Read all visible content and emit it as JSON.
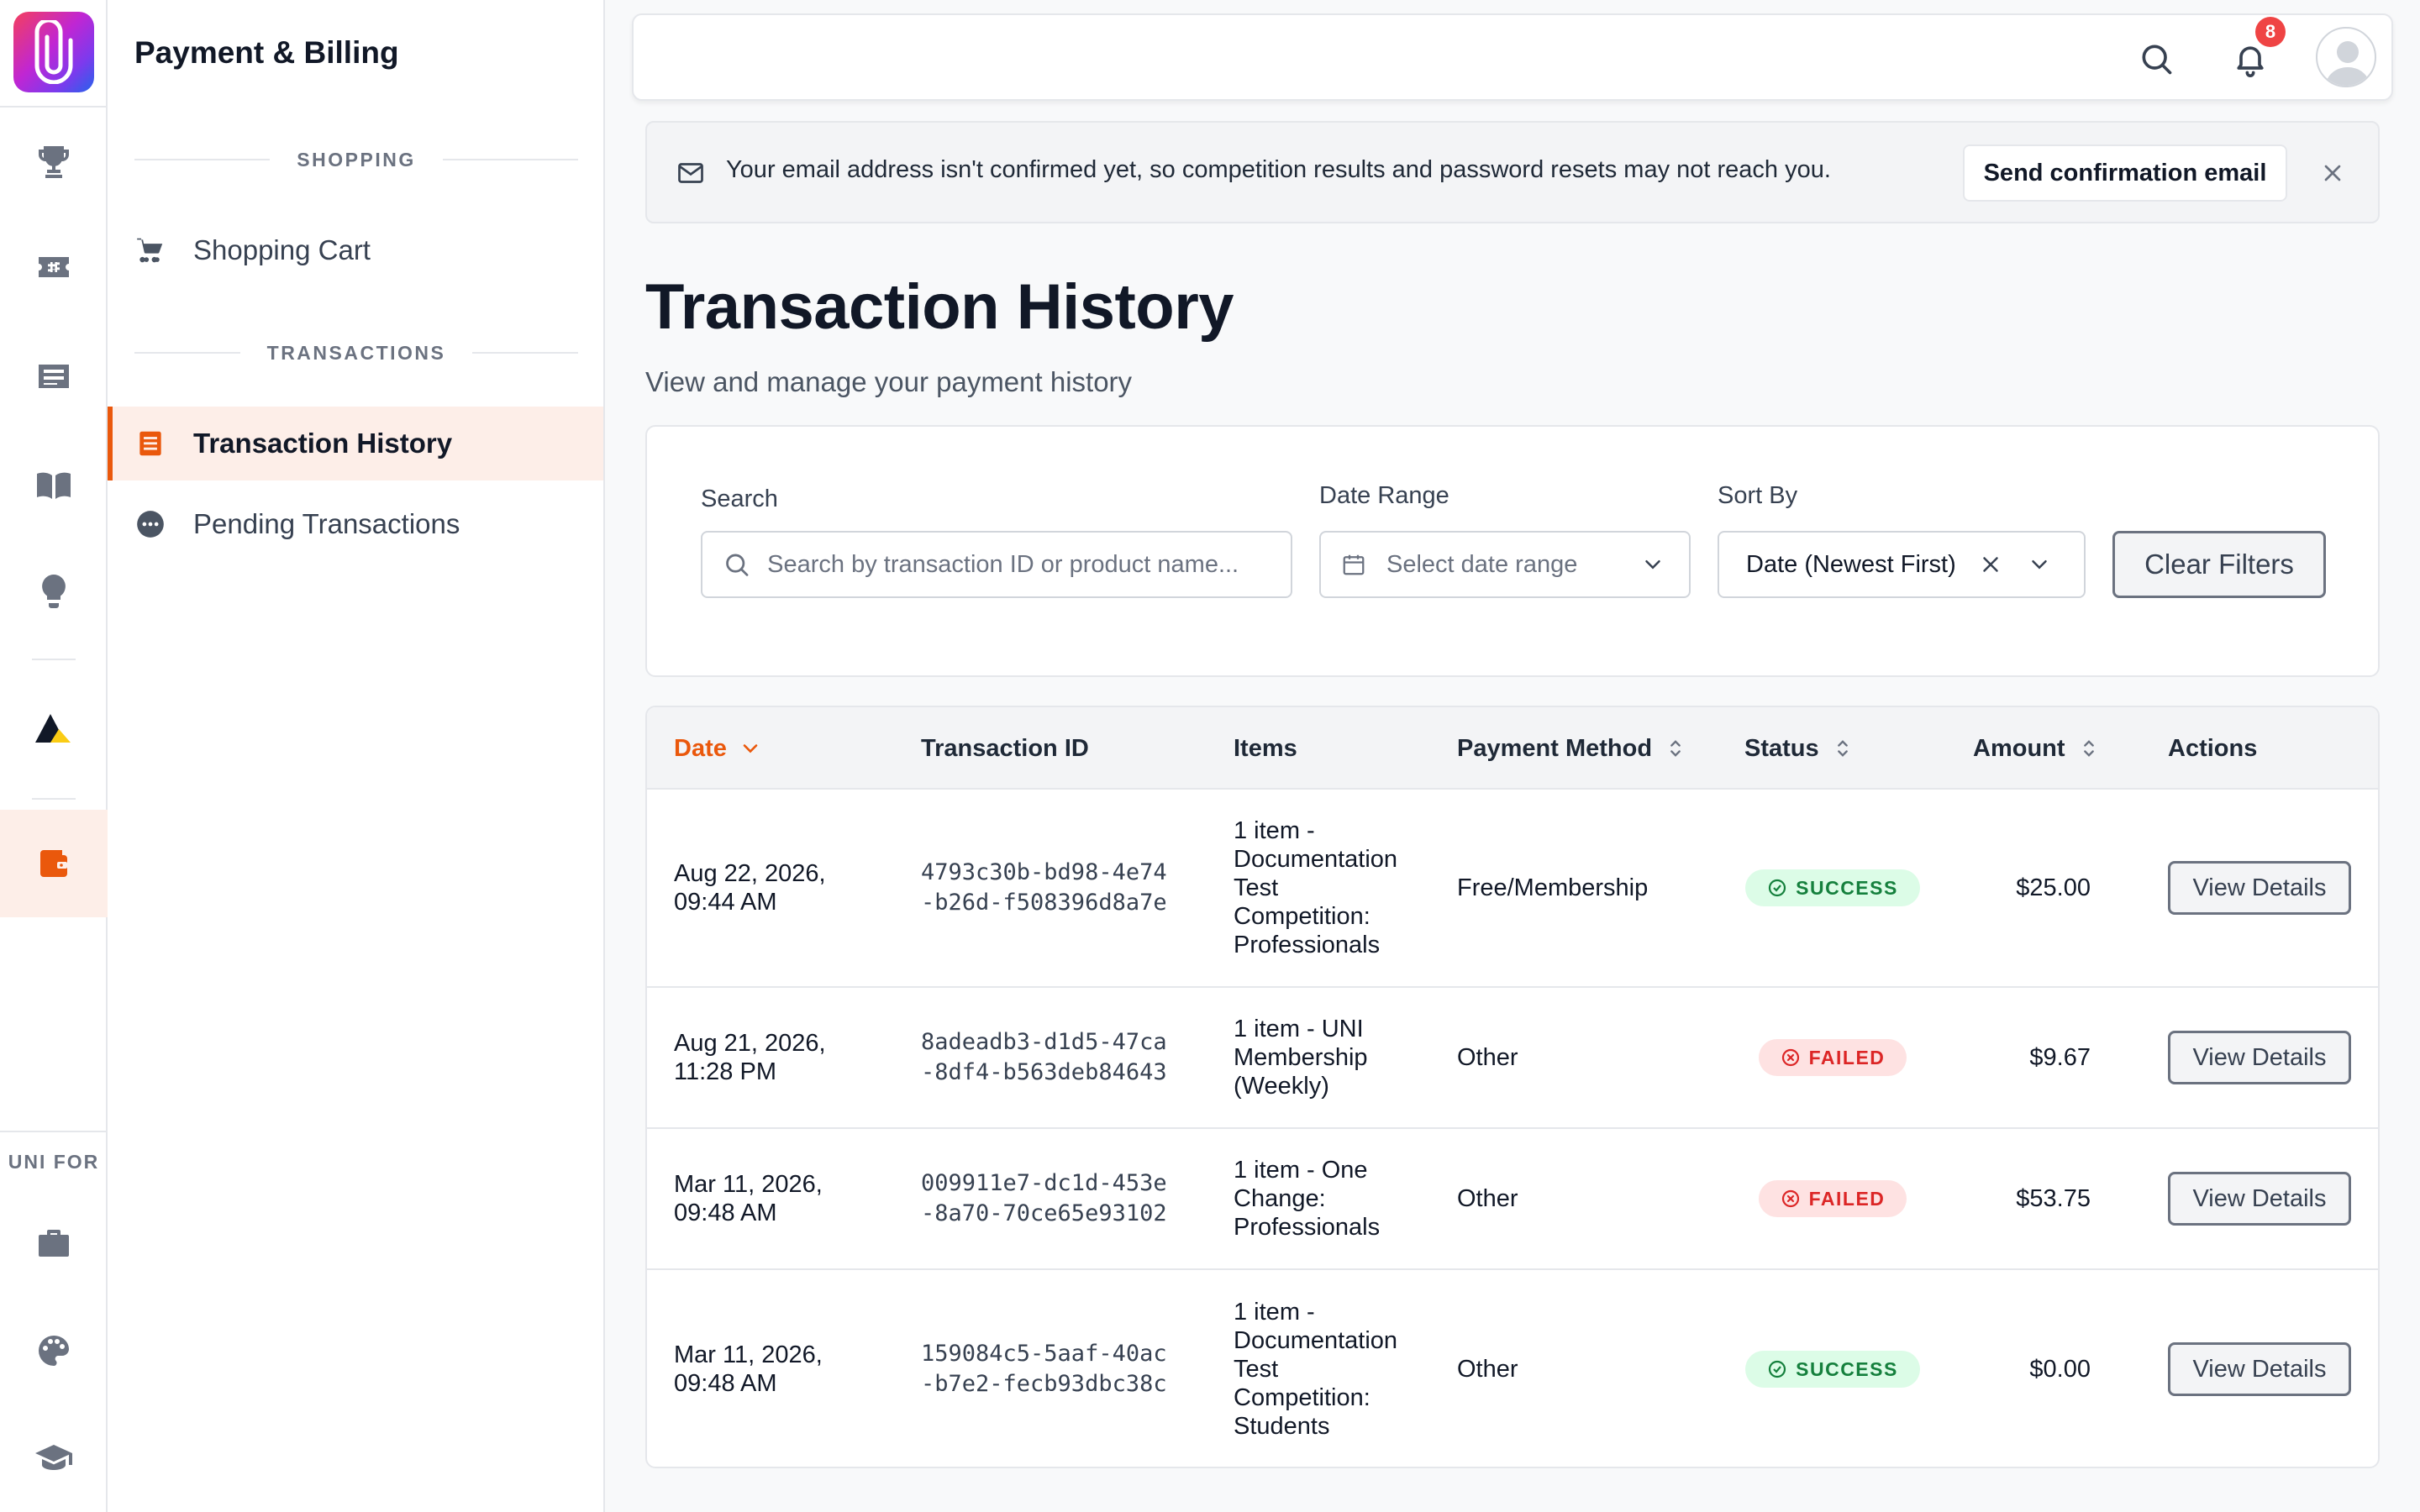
{
  "sidebar": {
    "title": "Payment & Billing",
    "sections": [
      {
        "label": "SHOPPING",
        "items": [
          {
            "label": "Shopping Cart",
            "icon": "cart-icon"
          }
        ]
      },
      {
        "label": "TRANSACTIONS",
        "items": [
          {
            "label": "Transaction History",
            "icon": "receipt-icon",
            "active": true
          },
          {
            "label": "Pending Transactions",
            "icon": "more-circle-icon"
          }
        ]
      }
    ]
  },
  "rail": {
    "icons": [
      "trophy-icon",
      "ticket-icon",
      "article-icon",
      "book-icon",
      "lightbulb-icon",
      "brand-triangle-icon",
      "wallet-icon",
      "briefcase-icon",
      "palette-icon",
      "graduation-cap-icon"
    ],
    "active": "wallet-icon",
    "section_label": "UNI FOR"
  },
  "topbar": {
    "notification_count": "8"
  },
  "banner": {
    "text": "Your email address isn't confirmed yet, so competition results and password resets may not reach you.",
    "button_label": "Send confirmation email"
  },
  "page": {
    "title": "Transaction History",
    "subtitle": "View and manage your payment history"
  },
  "filters": {
    "search_label": "Search",
    "search_placeholder": "Search by transaction ID or product name...",
    "date_label": "Date Range",
    "date_placeholder": "Select date range",
    "sort_label": "Sort By",
    "sort_value": "Date (Newest First)",
    "clear_label": "Clear Filters"
  },
  "table": {
    "columns": [
      "Date",
      "Transaction ID",
      "Items",
      "Payment Method",
      "Status",
      "Amount",
      "Actions"
    ],
    "rows": [
      {
        "date_line1": "Aug 22, 2026,",
        "date_line2": "09:44 AM",
        "id_line1": "4793c30b-bd98-4e74",
        "id_line2": "-b26d-f508396d8a7e",
        "items": [
          "1 item -",
          "Documentation",
          "Test",
          "Competition:",
          "Professionals"
        ],
        "method": "Free/Membership",
        "status": "SUCCESS",
        "amount": "$25.00",
        "action": "View Details"
      },
      {
        "date_line1": "Aug 21, 2026,",
        "date_line2": "11:28 PM",
        "id_line1": "8adeadb3-d1d5-47ca",
        "id_line2": "-8df4-b563deb84643",
        "items": [
          "1 item - UNI",
          "Membership",
          "(Weekly)"
        ],
        "method": "Other",
        "status": "FAILED",
        "amount": "$9.67",
        "action": "View Details"
      },
      {
        "date_line1": "Mar 11, 2026,",
        "date_line2": "09:48 AM",
        "id_line1": "009911e7-dc1d-453e",
        "id_line2": "-8a70-70ce65e93102",
        "items": [
          "1 item - One",
          "Change:",
          "Professionals"
        ],
        "method": "Other",
        "status": "FAILED",
        "amount": "$53.75",
        "action": "View Details"
      },
      {
        "date_line1": "Mar 11, 2026,",
        "date_line2": "09:48 AM",
        "id_line1": "159084c5-5aaf-40ac",
        "id_line2": "-b7e2-fecb93dbc38c",
        "items": [
          "1 item -",
          "Documentation",
          "Test",
          "Competition:",
          "Students"
        ],
        "method": "Other",
        "status": "SUCCESS",
        "amount": "$0.00",
        "action": "View Details"
      }
    ]
  },
  "colors": {
    "accent": "#ea580c",
    "accent_bg": "#fdeee8",
    "success": "#15803d",
    "failed": "#dc2626"
  }
}
